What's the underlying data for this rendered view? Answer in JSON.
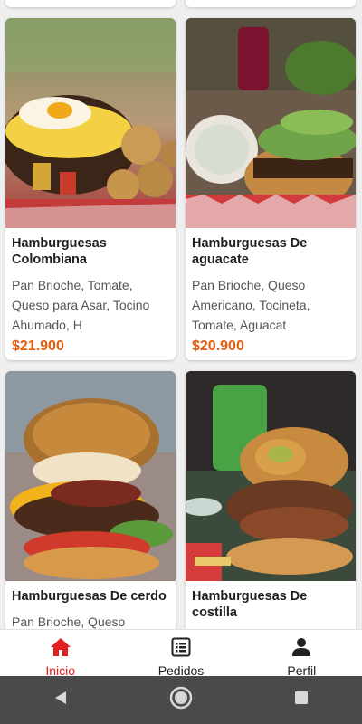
{
  "products": [
    {
      "title": "Hamburguesas Colombiana",
      "description": "Pan Brioche, Tomate, Queso para Asar, Tocino Ahumado, H",
      "price": "$21.900",
      "image": "hamburger-colombiana-photo"
    },
    {
      "title": "Hamburguesas De aguacate",
      "description": "Pan Brioche, Queso Americano, Tocineta, Tomate, Aguacat",
      "price": "$20.900",
      "image": "hamburger-aguacate-photo"
    },
    {
      "title": "Hamburguesas De cerdo",
      "description": "Pan Brioche, Queso",
      "price": "",
      "image": "hamburger-cerdo-photo"
    },
    {
      "title": "Hamburguesas De costilla",
      "description": "",
      "price": "",
      "image": "hamburger-costilla-photo"
    }
  ],
  "nav": {
    "inicio": {
      "label": "Inicio",
      "icon": "home-icon"
    },
    "pedidos": {
      "label": "Pedidos",
      "icon": "list-icon"
    },
    "perfil": {
      "label": "Perfil",
      "icon": "person-icon"
    }
  },
  "colors": {
    "accent": "#e02020",
    "price": "#e85d0c"
  }
}
